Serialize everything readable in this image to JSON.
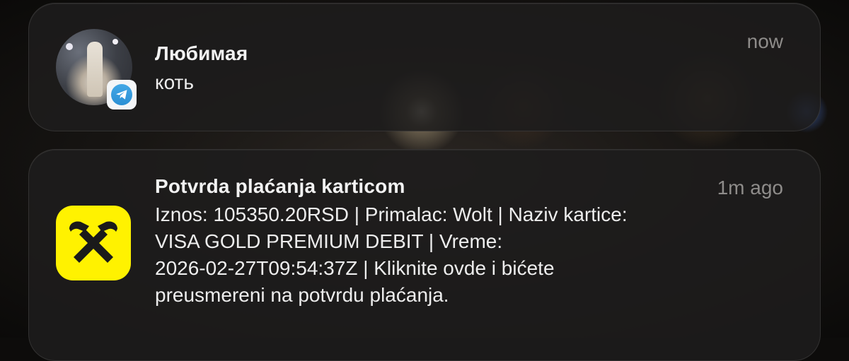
{
  "notifications": [
    {
      "title": "Любимая",
      "body": "коть",
      "time": "now",
      "icon": "avatar-photo",
      "badge_icon": "telegram-icon",
      "badge_color": "#2a9fd8"
    },
    {
      "title": "Potvrda plaćanja karticom",
      "body": [
        "Iznos: 105350.20RSD | Primalac: Wolt | Naziv kartice:",
        "VISA GOLD PREMIUM DEBIT | Vreme:",
        "2026-02-27T09:54:37Z | Kliknite ovde i bićete",
        "preusmereni na potvrdu plaćanja."
      ],
      "time": "1m ago",
      "icon": "raiffeisen-logo-icon",
      "icon_color": "#fff200"
    }
  ]
}
